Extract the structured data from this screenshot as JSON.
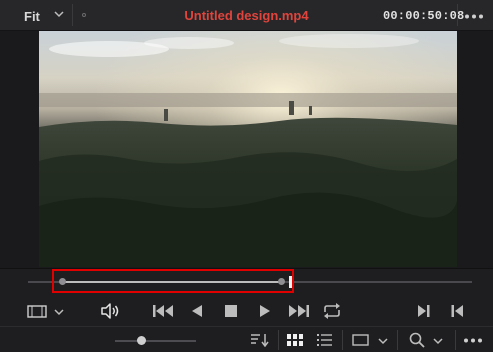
{
  "header": {
    "fit_label": "Fit",
    "title": "Untitled design.mp4",
    "timecode": "00:00:50:08"
  },
  "colors": {
    "title": "#e0443c",
    "highlight_border": "#e00000",
    "background": "#1e1e20"
  },
  "scrubber": {
    "in_point_fraction": 0.08,
    "out_point_fraction": 0.58,
    "playhead_fraction": 0.59
  },
  "transport": {
    "icons": [
      "clip-view-icon",
      "chevron-down-icon",
      "volume-icon",
      "skip-to-start-icon",
      "play-reverse-icon",
      "stop-icon",
      "play-icon",
      "skip-to-end-icon",
      "loop-icon",
      "next-frame-icon",
      "previous-frame-icon"
    ]
  },
  "bottombar": {
    "zoom_fraction": 0.3,
    "icons": [
      "sort-icon",
      "grid-view-icon",
      "list-view-icon",
      "monitor-icon",
      "search-icon",
      "more-icon"
    ]
  }
}
